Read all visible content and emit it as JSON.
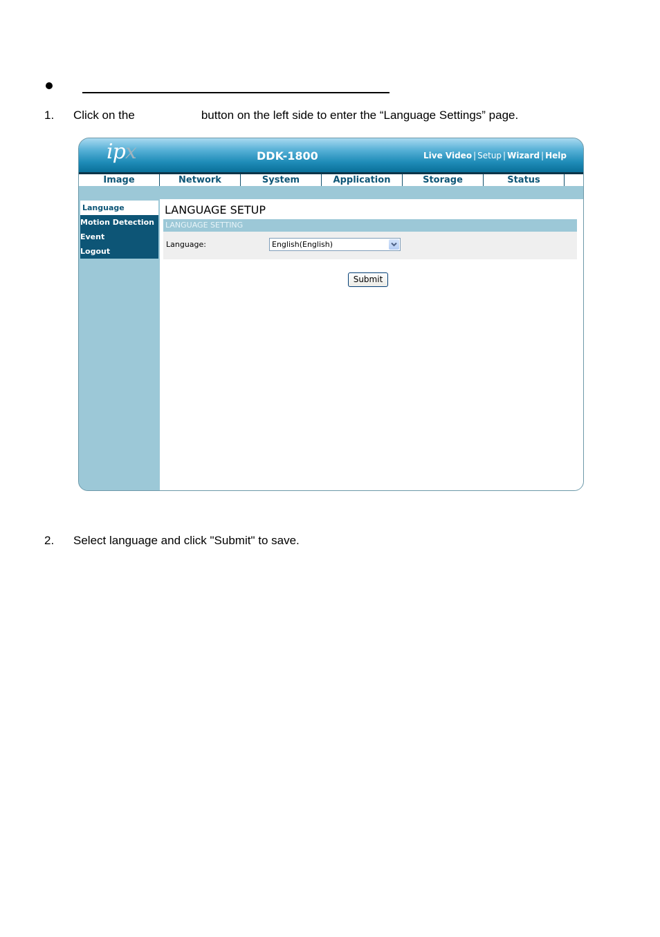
{
  "document": {
    "step1": {
      "number": "1.",
      "text_before": "Click on the",
      "text_after": "button on the left side to enter the “Language Settings” page."
    },
    "step2": {
      "number": "2.",
      "text": "Select language and click \"Submit\" to save."
    }
  },
  "screenshot": {
    "logo": {
      "main": "ip",
      "accent": "x"
    },
    "model": "DDK-1800",
    "top_links": [
      {
        "label": "Live Video",
        "bold": true
      },
      {
        "label": "Setup",
        "bold": false
      },
      {
        "label": "Wizard",
        "bold": true
      },
      {
        "label": "Help",
        "bold": true
      }
    ],
    "separator": "|",
    "tabs": [
      "Image",
      "Network",
      "System",
      "Application",
      "Storage",
      "Status"
    ],
    "sidebar": {
      "items": [
        {
          "label": "Language",
          "active": true
        },
        {
          "label": "Motion Detection",
          "active": false
        },
        {
          "label": "Event",
          "active": false
        },
        {
          "label": "Logout",
          "active": false
        }
      ]
    },
    "page_title": "LANGUAGE SETUP",
    "section_title": "LANGUAGE SETTING",
    "language_label": "Language:",
    "language_value": "English(English)",
    "submit_label": "Submit",
    "colors": {
      "navy": "#0d5576",
      "light_blue": "#9cc8d7",
      "row_gray": "#efefef"
    }
  }
}
